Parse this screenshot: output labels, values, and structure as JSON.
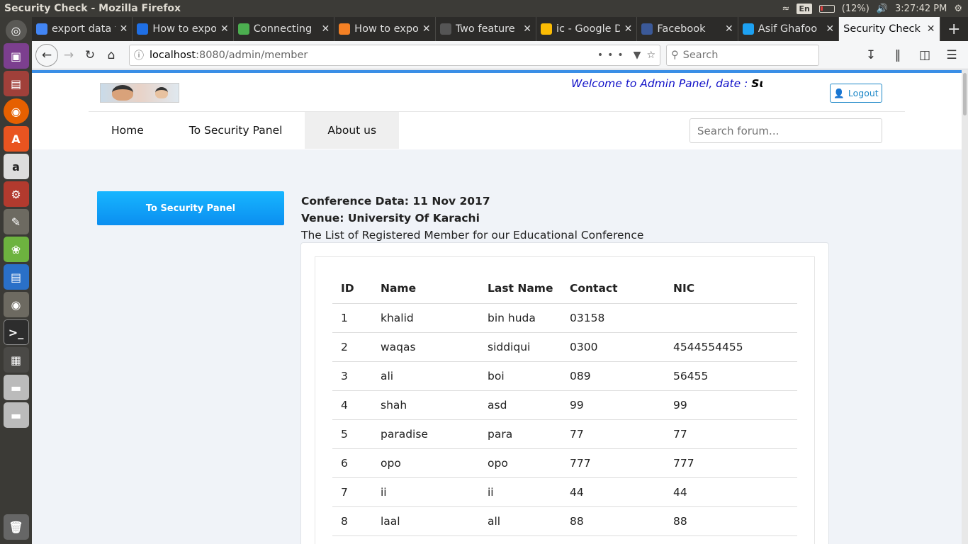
{
  "window": {
    "title": "Security Check - Mozilla Firefox"
  },
  "indicators": {
    "lang": "En",
    "battery": "(12%)",
    "time": "3:27:42 PM"
  },
  "launcher": [
    "ubuntu-dash",
    "files",
    "disk",
    "firefox",
    "software-center",
    "amazon",
    "settings",
    "text-editor",
    "spring-tool",
    "libreoffice-writer",
    "gimp",
    "terminal",
    "workspaces",
    "drive-1",
    "drive-2",
    "trash"
  ],
  "tabs": [
    {
      "label": "export data t",
      "icon": "google-icon",
      "color": "#4285f4"
    },
    {
      "label": "How to expo",
      "icon": "blue-swirl-icon",
      "color": "#1f6fe5"
    },
    {
      "label": "Connecting",
      "icon": "green-leaf-icon",
      "color": "#4caf50"
    },
    {
      "label": "How to expo",
      "icon": "stackoverflow-icon",
      "color": "#f48024"
    },
    {
      "label": "Two feature",
      "icon": "dark-swirl-icon",
      "color": "#555555"
    },
    {
      "label": "ic - Google D",
      "icon": "google-drive-icon",
      "color": "#fbbc04"
    },
    {
      "label": "Facebook",
      "icon": "facebook-icon",
      "color": "#3b5998"
    },
    {
      "label": "Asif Ghafoo",
      "icon": "twitter-icon",
      "color": "#1da1f2"
    },
    {
      "label": "Security Check",
      "icon": "",
      "color": ""
    }
  ],
  "url": {
    "host": "localhost",
    "rest": ":8080/admin/member"
  },
  "browser_search": {
    "placeholder": "Search"
  },
  "site": {
    "welcome_text": "Welcome to Admin Panel, date : ",
    "welcome_date": "Sun Je",
    "logout": "Logout",
    "nav": [
      "Home",
      "To Security Panel",
      "About us"
    ],
    "forum_search_placeholder": "Search forum..."
  },
  "sidebar": {
    "button": "To Security Panel"
  },
  "conference": {
    "date": "Conference Data: 11 Nov 2017",
    "venue": "Venue: University Of Karachi",
    "desc": "The List of Registered Member for our Educational Conference"
  },
  "table": {
    "headers": [
      "ID",
      "Name",
      "Last Name",
      "Contact",
      "NIC"
    ],
    "rows": [
      [
        "1",
        "khalid",
        "bin huda",
        "03158",
        ""
      ],
      [
        "2",
        "waqas",
        "siddiqui",
        "0300",
        "4544554455"
      ],
      [
        "3",
        "ali",
        "boi",
        "089",
        "56455"
      ],
      [
        "4",
        "shah",
        "asd",
        "99",
        "99"
      ],
      [
        "5",
        "paradise",
        "para",
        "77",
        "77"
      ],
      [
        "6",
        "opo",
        "opo",
        "777",
        "777"
      ],
      [
        "7",
        "ii",
        "ii",
        "44",
        "44"
      ],
      [
        "8",
        "laal",
        "all",
        "88",
        "88"
      ]
    ]
  }
}
